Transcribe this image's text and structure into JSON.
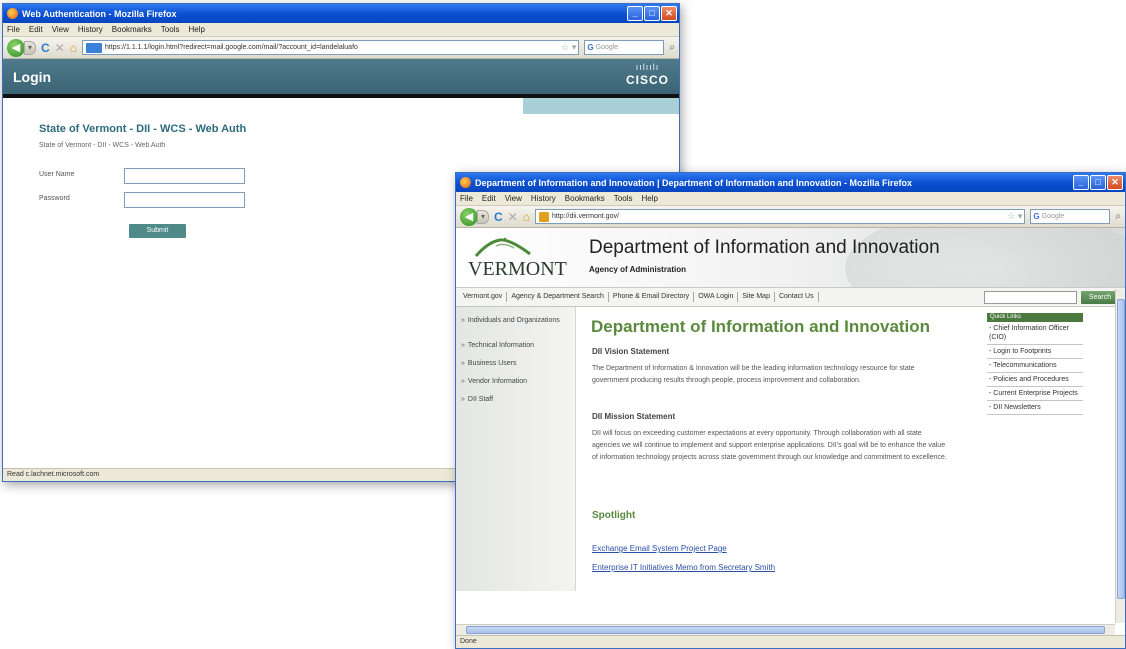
{
  "login_window": {
    "title": "Web Authentication - Mozilla Firefox",
    "menu": [
      "File",
      "Edit",
      "View",
      "History",
      "Bookmarks",
      "Tools",
      "Help"
    ],
    "url": "https://1.1.1.1/login.html?redirect=mail.google.com/mail/?account_id=landelaluafo",
    "search_placeholder": "Google",
    "header_title": "Login",
    "logo_bars": "ıılıılı",
    "logo_word": "CISCO",
    "heading": "State of Vermont - DII - WCS - Web Auth",
    "subheading": "State of Vermont - DII - WCS - Web Auth",
    "username_label": "User Name",
    "password_label": "Password",
    "submit_label": "Submit",
    "status": "Read c.lachnet.microsoft.com"
  },
  "dii_window": {
    "title": "Department of Information and Innovation | Department of Information and Innovation - Mozilla Firefox",
    "menu": [
      "File",
      "Edit",
      "View",
      "History",
      "Bookmarks",
      "Tools",
      "Help"
    ],
    "url": "http://dii.vermont.gov/",
    "search_placeholder": "Google",
    "logo_text": "VERMONT",
    "site_title": "Department of Information and Innovation",
    "site_subtitle": "Agency of Administration",
    "top_nav": [
      "Vermont.gov",
      "Agency & Department Search",
      "Phone & Email Directory",
      "OWA Login",
      "Site Map",
      "Contact Us"
    ],
    "search_button": "Search",
    "left_nav": [
      "Individuals and Organizations",
      "Technical Information",
      "Business Users",
      "Vendor Information",
      "DII Staff"
    ],
    "main_heading": "Department of Information and Innovation",
    "vision_heading": "DII Vision Statement",
    "vision_text": "The Department of Information & Innovation will be the leading information technology resource for state government producing results through people, process improvement and collaboration.",
    "mission_heading": "DII Mission Statement",
    "mission_text": "DII will focus on exceeding customer expectations at every opportunity. Through collaboration with all state agencies we will continue to implement and support enterprise applications. DII's goal will be to enhance the value of information technology projects across state government through our knowledge and commitment to excellence.",
    "spotlight_heading": "Spotlight",
    "spotlight_links": [
      "Exchange Email System Project Page",
      "Enterprise IT Initiatives Memo from Secretary Smith"
    ],
    "quick_links_heading": "Quick Links",
    "quick_links": [
      "Chief Information Officer (CIO)",
      "Login to Footprints",
      "Telecommunications",
      "Policies and Procedures",
      "Current Enterprise Projects",
      "DII Newsletters"
    ],
    "status": "Done"
  },
  "colors": {
    "titlebar": "#0a4fd0",
    "cisco_header": "#3b6474",
    "vermont_green": "#5a8a3e",
    "link_blue": "#2b4fa8"
  }
}
